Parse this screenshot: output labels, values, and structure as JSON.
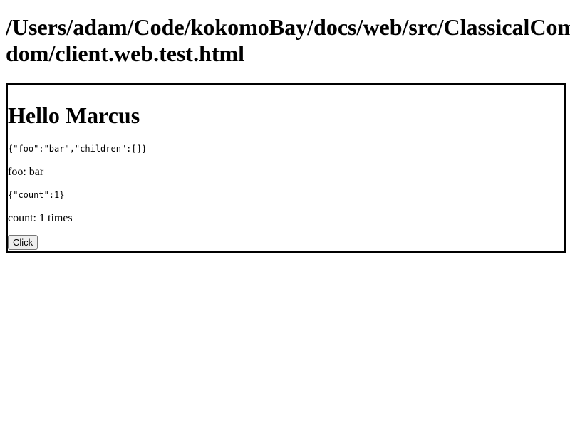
{
  "page": {
    "title_line1": "/Users/adam/Code/kokomoBay/docs/web/src/ClassicalComponent/react-test-renderer/dom/client.web.test.html",
    "title_line2": "dom/client.web.test.html"
  },
  "component": {
    "greeting": "Hello Marcus",
    "props_json": "{\"foo\":\"bar\",\"children\":[]}",
    "foo_text": "foo: bar",
    "state_json": "{\"count\":1}",
    "count_text": "count: 1 times",
    "button_label": "Click"
  }
}
